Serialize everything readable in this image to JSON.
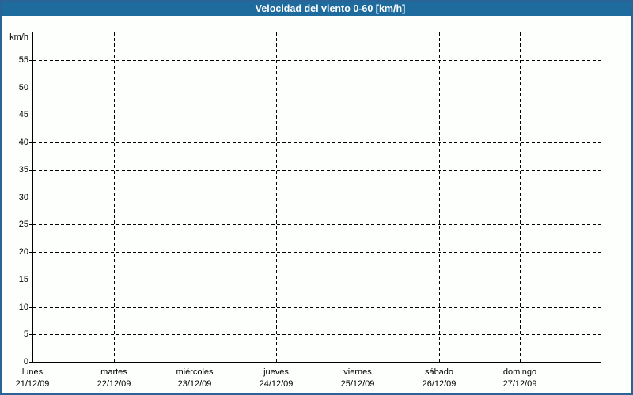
{
  "window": {
    "border_color": "#2a6496",
    "background_color": "#fdfffd"
  },
  "header": {
    "background_color": "#1e6b9d",
    "text_color": "#ffffff"
  },
  "chart_data": {
    "type": "line",
    "title": "Velocidad del viento 0-60 [km/h]",
    "ylabel": "km/h",
    "xlabel": "",
    "ylim": [
      0,
      60
    ],
    "yticks": [
      0,
      5,
      10,
      15,
      20,
      25,
      30,
      35,
      40,
      45,
      50,
      55
    ],
    "x_categories": [
      {
        "day": "lunes",
        "date": "21/12/09"
      },
      {
        "day": "martes",
        "date": "22/12/09"
      },
      {
        "day": "miércoles",
        "date": "23/12/09"
      },
      {
        "day": "jueves",
        "date": "24/12/09"
      },
      {
        "day": "viernes",
        "date": "25/12/09"
      },
      {
        "day": "sábado",
        "date": "26/12/09"
      },
      {
        "day": "domingo",
        "date": "27/12/09"
      }
    ],
    "series": [],
    "grid": "dashed",
    "legend": "none"
  }
}
